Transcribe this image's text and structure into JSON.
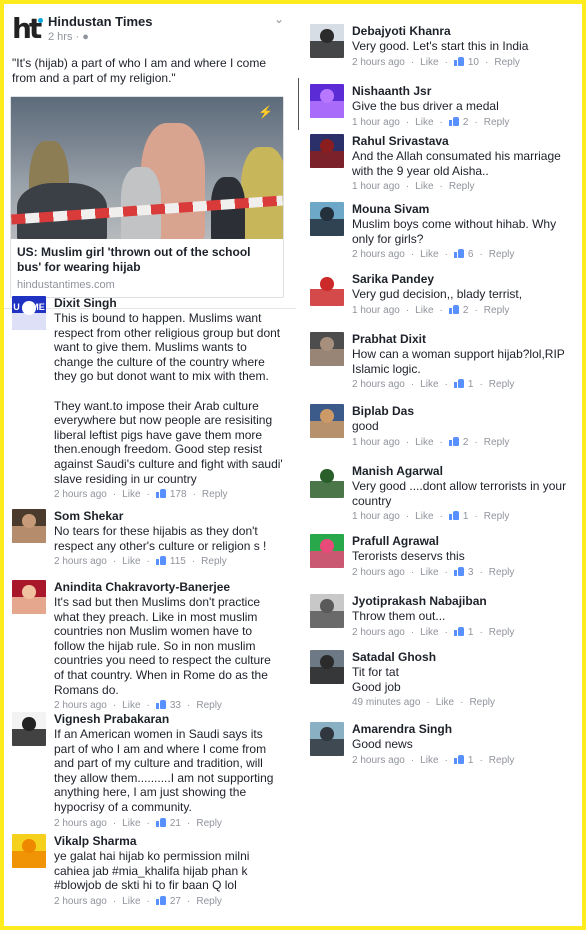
{
  "post": {
    "page_name": "Hindustan Times",
    "logo_text": "ht",
    "time": "2 hrs",
    "text": "\"It's (hijab) a part of who I am and where I come from and a part of my religion.\"",
    "link_title": "US: Muslim girl 'thrown out of the school bus' for wearing hijab",
    "link_domain": "hindustantimes.com"
  },
  "left_comments": [
    {
      "name": "Dixit Singh",
      "text": "This is bound to happen. Muslims want respect from other religious group but dont want to give them. Muslims wants to change the culture of the country where they go but donot want to mix with them.\n\nThey want.to impose their Arab culture everywhere but now people are resisiting liberal leftist pigs have gave them more then.enough freedom. Good step resist against Saudi's culture and fight with saudi' slave residing in ur country",
      "time": "2 hours ago",
      "like": "Like",
      "likes": "178",
      "reply": "Reply",
      "avatar_text": "U C ME"
    },
    {
      "name": "Som Shekar",
      "text": "No tears for these hijabis as they don't respect any other's culture or religion s !",
      "time": "2 hours ago",
      "like": "Like",
      "likes": "115",
      "reply": "Reply"
    },
    {
      "name": "Anindita Chakravorty-Banerjee",
      "text": "It's sad but then Muslims don't practice what they preach. Like in most muslim countries non Muslim women have to follow the hijab rule. So in non muslim countries you need to respect the culture of that country. When in Rome do as the Romans do.",
      "time": "2 hours ago",
      "like": "Like",
      "likes": "33",
      "reply": "Reply"
    },
    {
      "name": "Vignesh Prabakaran",
      "text": "If an American women in Saudi says its part of who I am and where I come from and part of my culture and tradition, will they allow them..........I am not supporting anything here, I am just showing the hypocrisy of a community.",
      "time": "2 hours ago",
      "like": "Like",
      "likes": "21",
      "reply": "Reply"
    },
    {
      "name": "Vikalp Sharma",
      "text": "ye galat hai hijab ko permission milni cahiea jab #mia_khalifa hijab phan k #blowjob de skti hi to fir baan Q lol",
      "time": "2 hours ago",
      "like": "Like",
      "likes": "27",
      "reply": "Reply"
    }
  ],
  "right_comments": [
    {
      "name": "Debajyoti Khanra",
      "text": "Very good. Let's start this in India",
      "time": "2 hours ago",
      "like": "Like",
      "likes": "10",
      "reply": "Reply"
    },
    {
      "name": "Nishaanth Jsr",
      "text": "Give the bus driver a medal",
      "time": "1 hour ago",
      "like": "Like",
      "likes": "2",
      "reply": "Reply"
    },
    {
      "name": "Rahul Srivastava",
      "text": "And the Allah consumated his marriage with the 9 year old Aisha..",
      "time": "1 hour ago",
      "like": "Like",
      "likes": "",
      "reply": "Reply"
    },
    {
      "name": "Mouna Sivam",
      "text": "Muslim boys come without hihab. Why only for girls?",
      "time": "2 hours ago",
      "like": "Like",
      "likes": "6",
      "reply": "Reply"
    },
    {
      "name": "Sarika Pandey",
      "text": "Very gud decision,, blady terrist,",
      "time": "1 hour ago",
      "like": "Like",
      "likes": "2",
      "reply": "Reply"
    },
    {
      "name": "Prabhat Dixit",
      "text": "How can a woman support hijab?lol,RIP Islamic logic.",
      "time": "2 hours ago",
      "like": "Like",
      "likes": "1",
      "reply": "Reply"
    },
    {
      "name": "Biplab Das",
      "text": "good",
      "time": "1 hour ago",
      "like": "Like",
      "likes": "2",
      "reply": "Reply"
    },
    {
      "name": "Manish Agarwal",
      "text": "Very good ....dont allow terrorists in your country",
      "time": "1 hour ago",
      "like": "Like",
      "likes": "1",
      "reply": "Reply"
    },
    {
      "name": "Prafull Agrawal",
      "text": "Terorists deservs this",
      "time": "2 hours ago",
      "like": "Like",
      "likes": "3",
      "reply": "Reply"
    },
    {
      "name": "Jyotiprakash Nabajiban",
      "text": "Throw them out...",
      "time": "2 hours ago",
      "like": "Like",
      "likes": "1",
      "reply": "Reply"
    },
    {
      "name": "Satadal Ghosh",
      "text": "Tit for tat \nGood job",
      "time": "49 minutes ago",
      "like": "Like",
      "likes": "",
      "reply": "Reply"
    },
    {
      "name": "Amarendra Singh",
      "text": "Good news",
      "time": "2 hours ago",
      "like": "Like",
      "likes": "1",
      "reply": "Reply"
    }
  ],
  "colors": {
    "border": "#ffeb1e",
    "meta": "#90949c",
    "like_blue": "#5890ff"
  }
}
